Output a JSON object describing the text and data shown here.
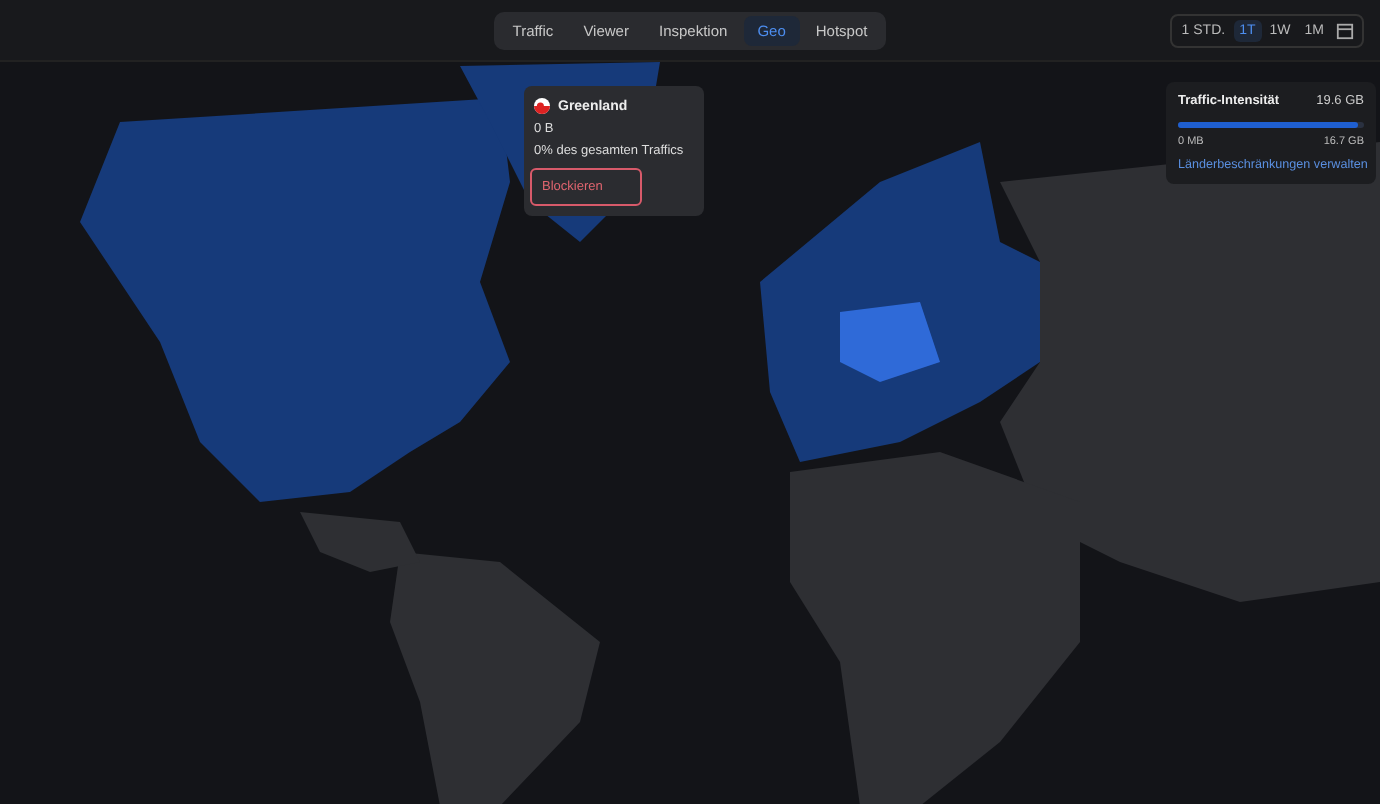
{
  "tabs": [
    {
      "label": "Traffic",
      "selected": false
    },
    {
      "label": "Viewer",
      "selected": false
    },
    {
      "label": "Inspektion",
      "selected": false
    },
    {
      "label": "Geo",
      "selected": true
    },
    {
      "label": "Hotspot",
      "selected": false
    }
  ],
  "time_ranges": [
    {
      "label": "1 STD.",
      "selected": false
    },
    {
      "label": "1T",
      "selected": true
    },
    {
      "label": "1W",
      "selected": false
    },
    {
      "label": "1M",
      "selected": false
    }
  ],
  "country_popup": {
    "country": "Greenland",
    "traffic": "0 B",
    "share": "0% des gesamten Traffics",
    "block_button": "Blockieren"
  },
  "intensity_panel": {
    "title": "Traffic-Intensität",
    "total": "19.6 GB",
    "level": 0.97,
    "min": "0 MB",
    "max": "16.7 GB",
    "link": "Länderbeschränkungen verwalten"
  }
}
